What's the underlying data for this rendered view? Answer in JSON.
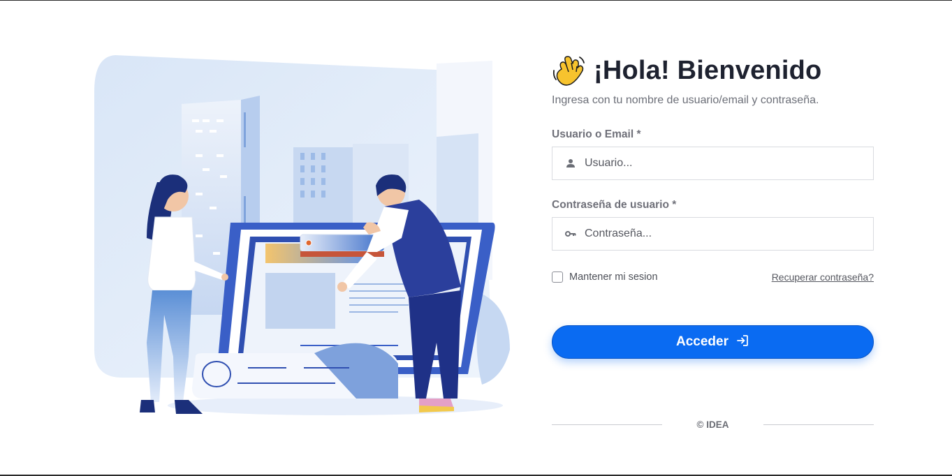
{
  "login": {
    "title": "¡Hola! Bienvenido",
    "subtitle": "Ingresa con tu nombre de usuario/email y contraseña.",
    "username_label": "Usuario o Email *",
    "username_placeholder": "Usuario...",
    "username_value": "",
    "password_label": "Contraseña de usuario *",
    "password_placeholder": "Contraseña...",
    "password_value": "",
    "remember_label": "Mantener mi sesion",
    "remember_checked": false,
    "forgot_label": "Recuperar contraseña?",
    "submit_label": "Acceder",
    "footer": "© IDEA"
  },
  "icons": {
    "title": "waving-hand-icon",
    "username": "user-icon",
    "password": "key-icon",
    "submit": "sign-in-icon"
  },
  "colors": {
    "primary": "#0a6bf2",
    "title_text": "#1e2230",
    "muted_text": "#6c6f78",
    "illustration_blue": "#2a4cb8"
  }
}
